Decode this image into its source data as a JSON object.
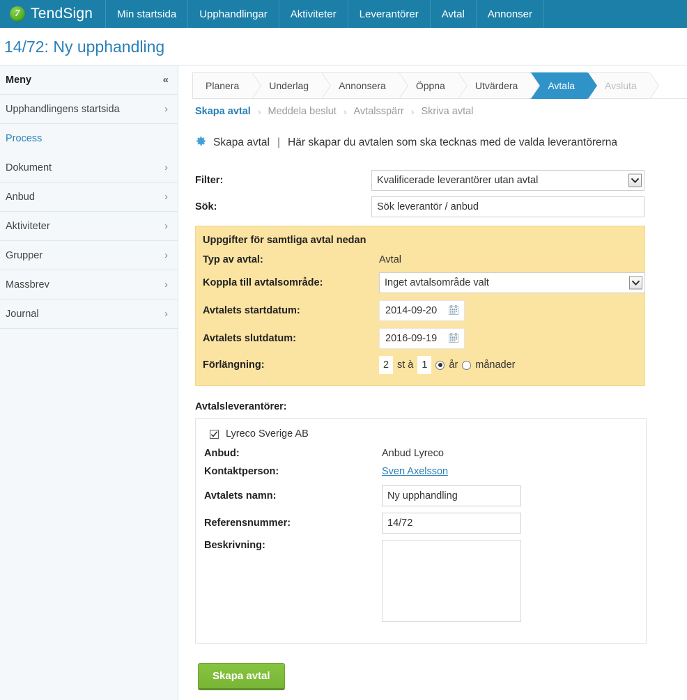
{
  "topnav": {
    "brand": "TendSign",
    "brand_logo_icon": "tendsign-logo-icon",
    "items": [
      {
        "label": "Min startsida"
      },
      {
        "label": "Upphandlingar"
      },
      {
        "label": "Aktiviteter"
      },
      {
        "label": "Leverantörer"
      },
      {
        "label": "Avtal"
      },
      {
        "label": "Annonser"
      }
    ]
  },
  "page": {
    "title": "14/72: Ny upphandling"
  },
  "sidebar": {
    "header": "Meny",
    "collapse_icon": "collapse-double-chevron-icon",
    "items": [
      {
        "label": "Upphandlingens startsida",
        "type": "link",
        "icon": "chevron-right-icon"
      },
      {
        "label": "Process",
        "type": "section"
      },
      {
        "label": "Dokument",
        "type": "link",
        "icon": "chevron-right-icon"
      },
      {
        "label": "Anbud",
        "type": "link",
        "icon": "chevron-right-icon"
      },
      {
        "label": "Aktiviteter",
        "type": "link",
        "icon": "chevron-right-icon"
      },
      {
        "label": "Grupper",
        "type": "link",
        "icon": "chevron-right-icon"
      },
      {
        "label": "Massbrev",
        "type": "link",
        "icon": "chevron-right-icon"
      },
      {
        "label": "Journal",
        "type": "link",
        "icon": "chevron-right-icon"
      }
    ]
  },
  "process": {
    "steps": [
      {
        "label": "Planera",
        "state": "done"
      },
      {
        "label": "Underlag",
        "state": "done"
      },
      {
        "label": "Annonsera",
        "state": "done"
      },
      {
        "label": "Öppna",
        "state": "done"
      },
      {
        "label": "Utvärdera",
        "state": "done"
      },
      {
        "label": "Avtala",
        "state": "active"
      },
      {
        "label": "Avsluta",
        "state": "disabled"
      }
    ],
    "substeps": [
      {
        "label": "Skapa avtal",
        "state": "current"
      },
      {
        "label": "Meddela beslut",
        "state": "disabled"
      },
      {
        "label": "Avtalsspärr",
        "state": "disabled"
      },
      {
        "label": "Skriva avtal",
        "state": "disabled"
      }
    ],
    "separator": "›"
  },
  "heading": {
    "icon": "gear-icon",
    "title": "Skapa avtal",
    "divider": "|",
    "description": "Här skapar du avtalen som ska tecknas med de valda leverantörerna"
  },
  "form": {
    "filter_label": "Filter:",
    "filter_value": "Kvalificerade leverantörer utan avtal",
    "search_label": "Sök:",
    "search_value": "Sök leverantör / anbud",
    "search_placeholder": "Sök leverantör / anbud"
  },
  "common_panel": {
    "title": "Uppgifter för samtliga avtal nedan",
    "type_label": "Typ av avtal:",
    "type_value": "Avtal",
    "area_label": "Koppla till avtalsområde:",
    "area_value": "Inget avtalsområde valt",
    "start_label": "Avtalets startdatum:",
    "start_value": "2014-09-20",
    "end_label": "Avtalets slutdatum:",
    "end_value": "2016-09-19",
    "extension_label": "Förlängning:",
    "extension_count": "2",
    "extension_middle": "st à",
    "extension_length": "1",
    "extension_unit_years": "år",
    "extension_unit_months": "månader",
    "extension_selected_unit": "år",
    "calendar_icon": "calendar-icon"
  },
  "suppliers": {
    "section_label": "Avtalsleverantörer:",
    "checkbox_icon": "checkbox-checked-icon",
    "supplier_name": "Lyreco Sverige AB",
    "bid_label": "Anbud:",
    "bid_value": "Anbud Lyreco",
    "contact_label": "Kontaktperson:",
    "contact_value": "Sven Axelsson",
    "name_label": "Avtalets namn:",
    "name_value": "Ny upphandling",
    "ref_label": "Referensnummer:",
    "ref_value": "14/72",
    "desc_label": "Beskrivning:",
    "desc_value": ""
  },
  "actions": {
    "submit_label": "Skapa avtal"
  },
  "colors": {
    "nav_blue": "#1b7fa8",
    "accent_blue": "#2980b9",
    "step_active": "#2f93c8",
    "panel_yellow": "#fbe3a1",
    "button_green": "#86c440"
  }
}
